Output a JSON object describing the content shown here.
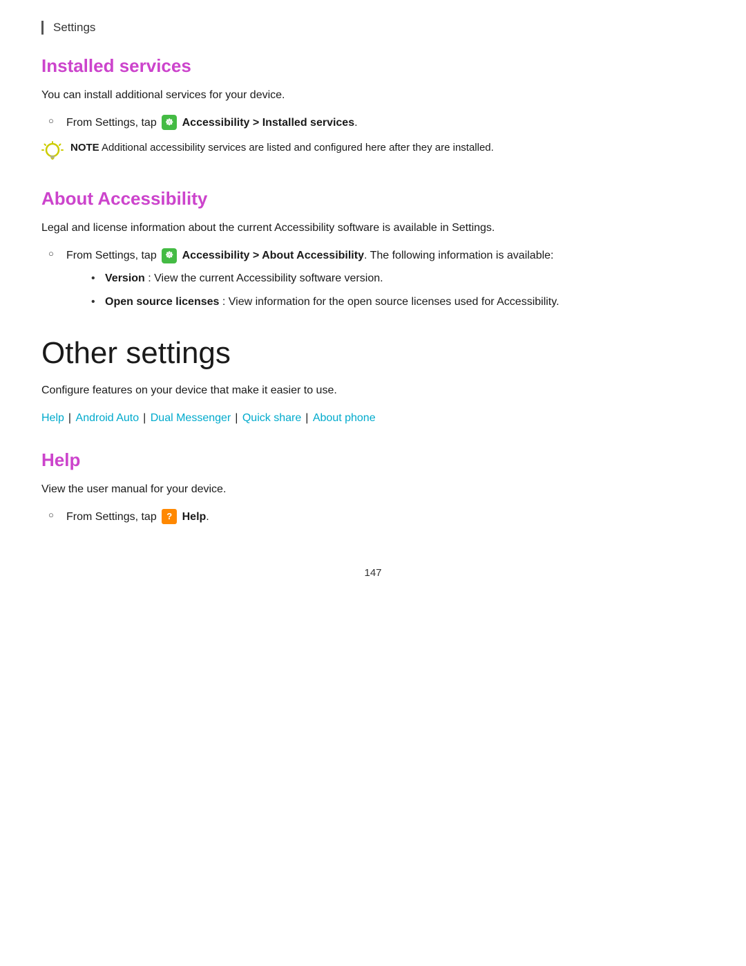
{
  "header": {
    "label": "Settings"
  },
  "installed_services": {
    "heading": "Installed services",
    "body": "You can install additional services for your device.",
    "list_item": "From Settings, tap",
    "list_item_bold": "Accessibility > Installed services",
    "list_item_suffix": ".",
    "note_label": "NOTE",
    "note_text": "Additional accessibility services are listed and configured here after they are installed."
  },
  "about_accessibility": {
    "heading": "About Accessibility",
    "body": "Legal and license information about the current Accessibility software is available in Settings.",
    "list_item_prefix": "From Settings, tap",
    "list_item_bold": "Accessibility > About Accessibility",
    "list_item_suffix": ". The following information is available:",
    "sub_items": [
      {
        "bold": "Version",
        "text": ": View the current Accessibility software version."
      },
      {
        "bold": "Open source licenses",
        "text": ": View information for the open source licenses used for Accessibility."
      }
    ]
  },
  "other_settings": {
    "heading": "Other settings",
    "body": "Configure features on your device that make it easier to use.",
    "links": [
      {
        "label": "Help",
        "separator": "|"
      },
      {
        "label": "Android Auto",
        "separator": "|"
      },
      {
        "label": "Dual Messenger",
        "separator": "|"
      },
      {
        "label": "Quick share",
        "separator": "|"
      },
      {
        "label": "About phone",
        "separator": ""
      }
    ]
  },
  "help_section": {
    "heading": "Help",
    "body": "View the user manual for your device.",
    "list_item_prefix": "From Settings, tap",
    "list_item_bold": "Help",
    "list_item_suffix": "."
  },
  "page_number": "147"
}
